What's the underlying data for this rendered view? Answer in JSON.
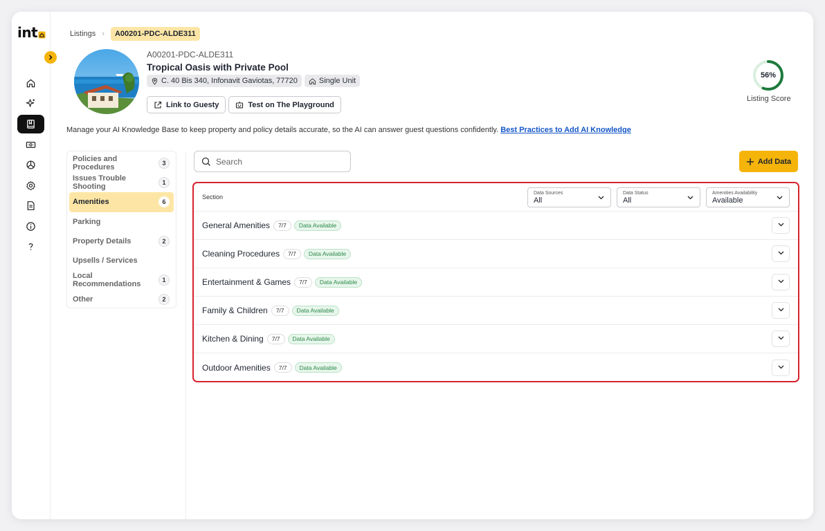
{
  "brand": {
    "logo_text": "int",
    "accent": "#f5b40a"
  },
  "breadcrumb": {
    "root": "Listings",
    "current": "A00201-PDC-ALDE311"
  },
  "listing": {
    "code": "A00201-PDC-ALDE311",
    "title": "Tropical Oasis with Private Pool",
    "address": "C. 40 Bis 340, Infonavit Gaviotas, 77720",
    "unit_type": "Single Unit",
    "link_label": "Link to Guesty",
    "test_label": "Test on The Playground"
  },
  "score": {
    "value": "56%",
    "percent": 56,
    "label": "Listing Score",
    "color": "#1e7a3c"
  },
  "intro": {
    "text": "Manage your AI Knowledge Base to keep property and policy details accurate, so the AI can answer guest questions confidently.",
    "link": "Best Practices to Add AI Knowledge"
  },
  "categories": [
    {
      "label": "Policies and Procedures",
      "count": "3"
    },
    {
      "label": "Issues Trouble Shooting",
      "count": "1"
    },
    {
      "label": "Amenities",
      "count": "6",
      "active": true
    },
    {
      "label": "Parking",
      "count": ""
    },
    {
      "label": "Property Details",
      "count": "2"
    },
    {
      "label": "Upsells / Services",
      "count": ""
    },
    {
      "label": "Local Recommendations",
      "count": "1"
    },
    {
      "label": "Other",
      "count": "2"
    }
  ],
  "search": {
    "placeholder": "Search"
  },
  "add_button": "Add Data",
  "table": {
    "section_header": "Section",
    "filters": [
      {
        "label": "Data Sources",
        "value": "All"
      },
      {
        "label": "Data Status",
        "value": "All"
      },
      {
        "label": "Amenities Availability",
        "value": "Available"
      }
    ],
    "rows": [
      {
        "title": "General Amenities",
        "count": "7/7",
        "status": "Data Available"
      },
      {
        "title": "Cleaning Procedures",
        "count": "7/7",
        "status": "Data Available"
      },
      {
        "title": "Entertainment & Games",
        "count": "7/7",
        "status": "Data Available"
      },
      {
        "title": "Family & Children",
        "count": "7/7",
        "status": "Data Available"
      },
      {
        "title": "Kitchen & Dining",
        "count": "7/7",
        "status": "Data Available"
      },
      {
        "title": "Outdoor Amenities",
        "count": "7/7",
        "status": "Data Available"
      }
    ]
  },
  "nav_icons": [
    "home-icon",
    "sparkle-icon",
    "book-icon",
    "money-icon",
    "chart-pie-icon",
    "gear-icon",
    "document-icon",
    "info-icon",
    "help-icon"
  ]
}
